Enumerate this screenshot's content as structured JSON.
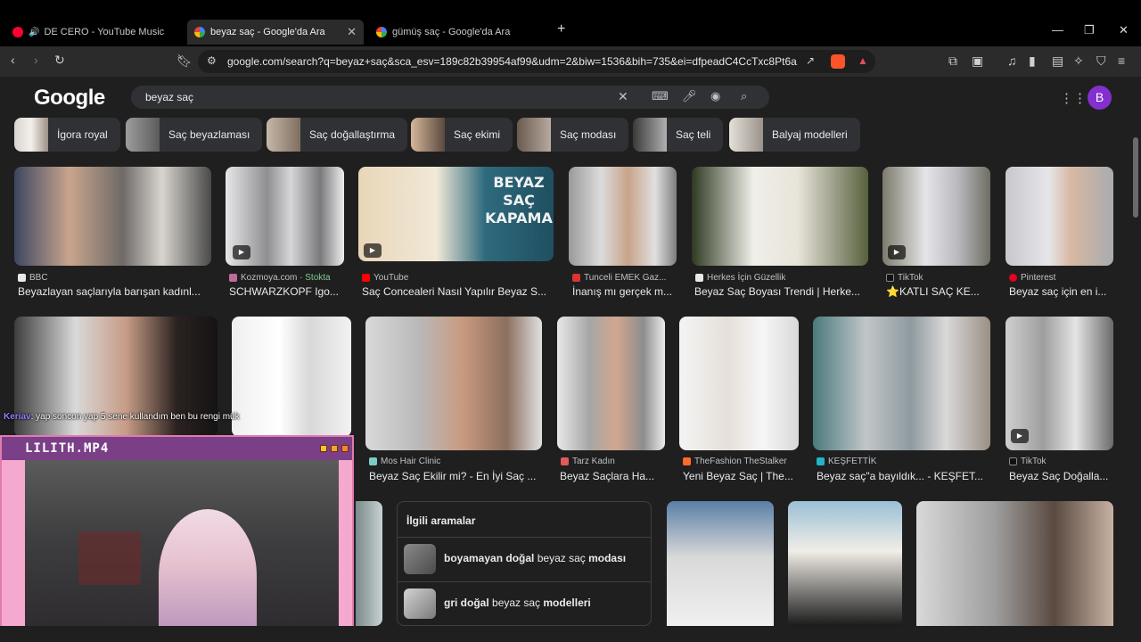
{
  "tabs": [
    {
      "title": "DE CERO - YouTube Music",
      "icon": "youtube-music-icon"
    },
    {
      "title": "beyaz saç - Google'da Ara",
      "icon": "google-icon"
    },
    {
      "title": "gümüş saç - Google'da Ara",
      "icon": "google-icon"
    }
  ],
  "address": {
    "url": "google.com/search?q=beyaz+saç&sca_esv=189c82b39954af99&udm=2&biw=1536&bih=735&ei=dfpeadC4CcTxc8Pt6a..."
  },
  "google": {
    "logo": "Google",
    "query": "beyaz saç",
    "avatar_letter": "B",
    "avatar_color": "#8430ce"
  },
  "chips": [
    "İgora royal",
    "Saç beyazlaması",
    "Saç doğallaştırma",
    "Saç ekimi",
    "Saç modası",
    "Saç teli",
    "Balyaj modelleri"
  ],
  "results_row1": [
    {
      "source": "BBC",
      "title": "Beyazlayan saçlarıyla barışan kadınl..."
    },
    {
      "source": "Kozmoya.com",
      "badge": "Stokta",
      "title": "SCHWARZKOPF Igo..."
    },
    {
      "source": "YouTube",
      "title": "Saç Concealeri Nasıl Yapılır Beyaz S..."
    },
    {
      "source": "Tunceli EMEK Gaz...",
      "title": "İnanış mı gerçek m..."
    },
    {
      "source": "Herkes İçin Güzellik",
      "title": "Beyaz Saç Boyası Trendi | Herke..."
    },
    {
      "source": "TikTok",
      "title": "⭐KATLI SAÇ KE..."
    },
    {
      "source": "Pinterest",
      "title": "Beyaz saç için en i..."
    }
  ],
  "results_row2": [
    {
      "source": "Mos Hair Clinic",
      "title": "Beyaz Saç Ekilir mi? - En İyi Saç ..."
    },
    {
      "source": "Tarz Kadın",
      "title": "Beyaz Saçlara Ha..."
    },
    {
      "source": "TheFashion TheStalker",
      "title": "Yeni Beyaz Saç | The..."
    },
    {
      "source": "KEŞFETTİK",
      "title": "Beyaz saç\"a bayıldık... - KEŞFET..."
    },
    {
      "source": "TikTok",
      "title": "Beyaz Saç Doğalla..."
    }
  ],
  "thumb_text": {
    "line1": "BEYAZ",
    "line2": "SAÇ",
    "line3": "KAPAMA"
  },
  "related": {
    "title": "İlgili aramalar",
    "items": [
      {
        "bold_a": "boyamayan doğal",
        "query": "beyaz saç",
        "bold_b": "modası"
      },
      {
        "bold_a": "gri doğal",
        "query": "beyaz saç",
        "bold_b": "modelleri"
      }
    ]
  },
  "chat": {
    "user": "Keriav",
    "message": ": yap soncon yap 5 sene kullandım ben bu rengi mük"
  },
  "webcam": {
    "title": "LILITH.MP4"
  }
}
